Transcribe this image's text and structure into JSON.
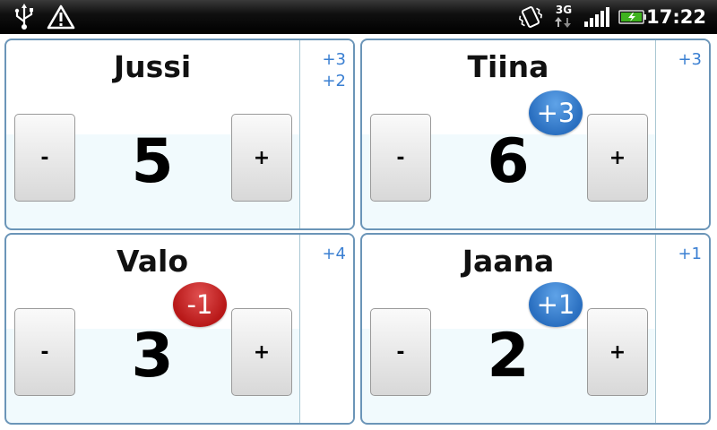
{
  "status_bar": {
    "time": "17:22",
    "network": "3G",
    "battery_color": "#3fb21f",
    "icons": [
      "usb-icon",
      "warning-icon",
      "vibrate-icon",
      "network-3g-icon",
      "signal-icon",
      "battery-charging-icon"
    ]
  },
  "colors": {
    "card_border": "#6b95b8",
    "history_text": "#3a7fd2",
    "badge_positive": "#2a6fc0",
    "badge_negative": "#b81818"
  },
  "players": [
    {
      "name": "Jussi",
      "score": "5",
      "minus_label": "-",
      "plus_label": "+",
      "badge": "",
      "history": [
        "+3",
        "+2"
      ]
    },
    {
      "name": "Tiina",
      "score": "6",
      "minus_label": "-",
      "plus_label": "+",
      "badge": "+3",
      "history": [
        "+3"
      ]
    },
    {
      "name": "Valo",
      "score": "3",
      "minus_label": "-",
      "plus_label": "+",
      "badge": "-1",
      "history": [
        "+4"
      ]
    },
    {
      "name": "Jaana",
      "score": "2",
      "minus_label": "-",
      "plus_label": "+",
      "badge": "+1",
      "history": [
        "+1"
      ]
    }
  ]
}
